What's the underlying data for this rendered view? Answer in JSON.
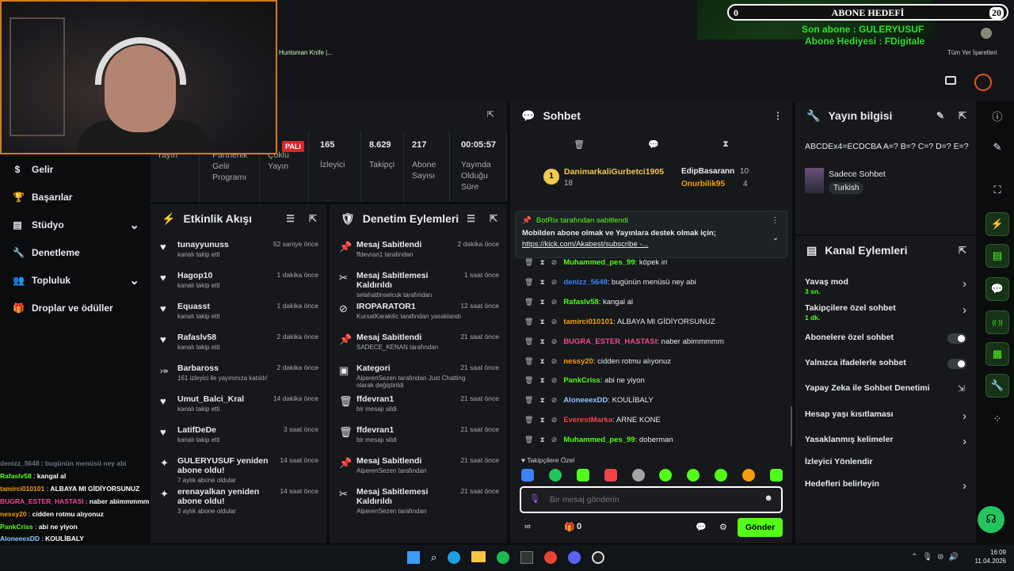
{
  "overlay": {
    "goal_title": "ABONE HEDEFİ",
    "goal_current": "0",
    "goal_target": "20",
    "last_sub": "Son abone : GULERYUSUF",
    "sub_gift": "Abone Hediyesi : FDigitale",
    "bookmark_left": "Huntsman Knife |...",
    "bookmark_right": "Tüm Yer İşaretleri",
    "live_badge": "PALI"
  },
  "sidebar": {
    "items": [
      {
        "label": "Gelir",
        "icon": "$"
      },
      {
        "label": "Başarılar",
        "icon": "🏆"
      },
      {
        "label": "Stüdyo",
        "icon": "▤"
      },
      {
        "label": "Denetleme",
        "icon": "🔧"
      },
      {
        "label": "Topluluk",
        "icon": "👥"
      },
      {
        "label": "Droplar ve ödüller",
        "icon": "🎁"
      }
    ]
  },
  "stream_stats": [
    {
      "label": "Yayın",
      "value": ""
    },
    {
      "label": "Partnerlik Gelir Programı",
      "value": ""
    },
    {
      "label": "Çoklu Yayın",
      "value": ""
    },
    {
      "label": "İzleyici",
      "value": "165"
    },
    {
      "label": "Takipçi",
      "value": "8.629"
    },
    {
      "label": "Abone Sayısı",
      "value": "217"
    },
    {
      "label": "Yayında Olduğu Süre",
      "value": "00:05:57"
    }
  ],
  "activity": {
    "title": "Etkinlik Akışı",
    "items": [
      {
        "name": "tunayyunuss",
        "sub": "kanalı takip etti",
        "time": "52 saniye önce",
        "icon": "♥"
      },
      {
        "name": "Hagop10",
        "sub": "kanalı takip etti",
        "time": "1 dakika önce",
        "icon": "♥"
      },
      {
        "name": "Equasst",
        "sub": "kanalı takip etti",
        "time": "1 dakika önce",
        "icon": "♥"
      },
      {
        "name": "Rafaslv58",
        "sub": "kanalı takip etti",
        "time": "2 dakika önce",
        "icon": "♥"
      },
      {
        "name": "Barbaross",
        "sub": "161 izleyici ile yayınınıza katıldı!",
        "time": "2 dakika önce",
        "icon": "⤖"
      },
      {
        "name": "Umut_Balci_Kral",
        "sub": "kanalı takip etti",
        "time": "14 dakika önce",
        "icon": "♥"
      },
      {
        "name": "LatifDeDe",
        "sub": "kanalı takip etti",
        "time": "3 saat önce",
        "icon": "♥"
      },
      {
        "name": "GULERYUSUF yeniden abone oldu!",
        "sub": "7 aylık abone oldular",
        "time": "14 saat önce",
        "icon": "✦"
      },
      {
        "name": "erenayalkan yeniden abone oldu!",
        "sub": "3 aylık abone oldular",
        "time": "14 saat önce",
        "icon": "✦"
      }
    ]
  },
  "moderation": {
    "title": "Denetim Eylemleri",
    "items": [
      {
        "name": "Mesaj Sabitlendi",
        "sub": "ffdevran1 tarafından",
        "time": "2 dakika önce",
        "icon": "📌"
      },
      {
        "name": "Mesaj Sabitlemesi Kaldırıldı",
        "sub": "selahattinselcuk tarafından",
        "time": "1 saat önce",
        "icon": "✂"
      },
      {
        "name": "IROPARATOR1",
        "sub": "KursatKarakilic tarafından yasaklandı",
        "time": "12 saat önce",
        "icon": "⊘"
      },
      {
        "name": "Mesaj Sabitlendi",
        "sub": "SADECE_KENAN tarafından",
        "time": "21 saat önce",
        "icon": "📌"
      },
      {
        "name": "Kategori",
        "sub": "AlperenSezen tarafından Just Chatting olarak değiştirildi",
        "time": "21 saat önce",
        "icon": "▣"
      },
      {
        "name": "ffdevran1",
        "sub": "bir mesajı sildi",
        "time": "21 saat önce",
        "icon": "🗑"
      },
      {
        "name": "ffdevran1",
        "sub": "bir mesajı sildi",
        "time": "21 saat önce",
        "icon": "🗑"
      },
      {
        "name": "Mesaj Sabitlendi",
        "sub": "AlperenSezen tarafından",
        "time": "21 saat önce",
        "icon": "📌"
      },
      {
        "name": "Mesaj Sabitlemesi Kaldırıldı",
        "sub": "AlperenSezen tarafından",
        "time": "21 saat önce",
        "icon": "✂"
      }
    ]
  },
  "chat": {
    "title": "Sohbet",
    "top_gifters": [
      {
        "name": "DanimarkaliGurbetci1905",
        "count": "18"
      },
      {
        "name": "EdipBasarann",
        "count": "10"
      },
      {
        "name": "Onurbilik95",
        "count": "4"
      }
    ],
    "pinned": {
      "by": "BotRix tarafından sabitlendi",
      "text": "Mobilden abone olmak ve Yayınlara destek olmak için;",
      "link": "https://kick.com/Akabest/subscribe -..."
    },
    "messages": [
      {
        "user": "Muhammed_pes_99",
        "color": "#53fc18",
        "text": "köpek iri"
      },
      {
        "user": "denizz_5648",
        "color": "#3b82f6",
        "text": "bugünün menüsü ney abi"
      },
      {
        "user": "Rafaslv58",
        "color": "#53fc18",
        "text": "kangal al"
      },
      {
        "user": "tamirci010101",
        "color": "#f59e0b",
        "text": "ALBAYA MI GİDİYORSUNUZ"
      },
      {
        "user": "BUGRA_ESTER_HASTASI",
        "color": "#ec4899",
        "text": "naber abimmmmm"
      },
      {
        "user": "nessy20",
        "color": "#f59e0b",
        "text": "cidden rotmu alıyonuz"
      },
      {
        "user": "PankCriss",
        "color": "#53fc18",
        "text": "abi ne yiyon"
      },
      {
        "user": "AloneeexDD",
        "color": "#93c5fd",
        "text": "KOULİBALY"
      },
      {
        "user": "EverestMarka",
        "color": "#ef4444",
        "text": "ARNE KONE"
      },
      {
        "user": "Muhammed_pes_99",
        "color": "#53fc18",
        "text": "doberman"
      }
    ],
    "mode_label": "Takipçilere Özel",
    "input_placeholder": "Bir mesaj gönderin",
    "points": "0",
    "send_label": "Gönder"
  },
  "stream_info": {
    "title": "Yayın bilgisi",
    "stream_title": "ABCDEx4=ECDCBA A=? B=? C=? D=? E=?",
    "category": "Sadece Sohbet",
    "language": "Turkish"
  },
  "channel_actions": {
    "title": "Kanal Eylemleri",
    "items": [
      {
        "label": "Yavaş mod",
        "sub": "3 sn.",
        "kind": "arrow"
      },
      {
        "label": "Takipçilere özel sohbet",
        "sub": "1 dk.",
        "kind": "arrow"
      },
      {
        "label": "Abonelere özel sohbet",
        "sub": "",
        "kind": "toggle"
      },
      {
        "label": "Yalnızca ifadelerle sohbet",
        "sub": "",
        "kind": "toggle"
      },
      {
        "label": "Yapay Zeka ile Sohbet Denetimi",
        "sub": "",
        "kind": "ext"
      },
      {
        "label": "Hesap yaşı kısıtlaması",
        "sub": "",
        "kind": "arrow"
      },
      {
        "label": "Yasaklanmış kelimeler",
        "sub": "",
        "kind": "arrow"
      },
      {
        "label": "İzleyici Yönlendir",
        "sub": "",
        "kind": "none"
      },
      {
        "label": "Hedefleri belirleyin",
        "sub": "",
        "kind": "arrow"
      }
    ]
  },
  "overlay_chat": [
    {
      "user": "denizz_5648",
      "color": "#6b7280",
      "text": "bugünün menüsü ney abi"
    },
    {
      "user": "Rafaslv58",
      "color": "#53fc18",
      "text": "kangal al"
    },
    {
      "user": "tamirci010101",
      "color": "#f59e0b",
      "text": "ALBAYA MI GİDİYORSUNUZ"
    },
    {
      "user": "BUGRA_ESTER_HASTASI",
      "color": "#ec4899",
      "text": "naber abimmmmm"
    },
    {
      "user": "nessy20",
      "color": "#f59e0b",
      "text": "cidden rotmu alıyonuz"
    },
    {
      "user": "PankCriss",
      "color": "#53fc18",
      "text": "abi ne yiyon"
    },
    {
      "user": "AloneeexDD",
      "color": "#93c5fd",
      "text": "KOULİBALY"
    },
    {
      "user": "EverestMarka",
      "color": "#ef4444",
      "text": "ARNE KONE"
    },
    {
      "user": "Muhammed_pes_99",
      "color": "#53fc18",
      "text": "doberman"
    }
  ],
  "taskbar": {
    "time": "16:09",
    "date": "11.04.2026"
  }
}
